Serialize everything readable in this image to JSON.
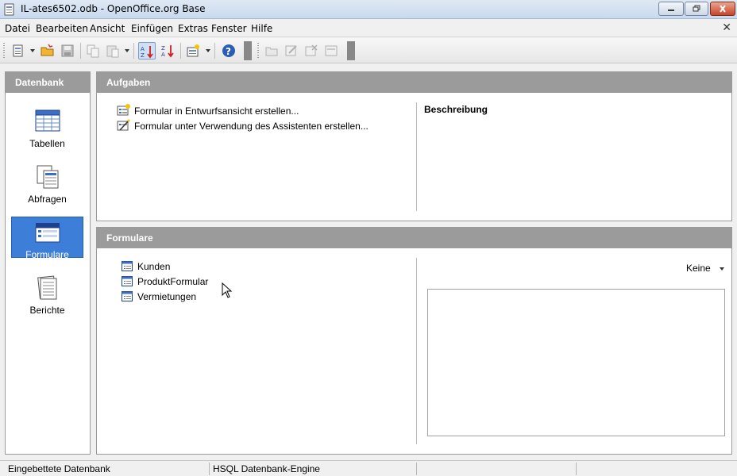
{
  "window": {
    "title": "IL-ates6502.odb - OpenOffice.org Base"
  },
  "menubar": {
    "items": [
      "Datei",
      "Bearbeiten",
      "Ansicht",
      "Einfügen",
      "Extras",
      "Fenster",
      "Hilfe"
    ]
  },
  "left_panel": {
    "header": "Datenbank",
    "items": [
      {
        "label": "Tabellen",
        "icon": "table-icon",
        "selected": false
      },
      {
        "label": "Abfragen",
        "icon": "query-icon",
        "selected": false
      },
      {
        "label": "Formulare",
        "icon": "form-icon",
        "selected": true
      },
      {
        "label": "Berichte",
        "icon": "report-icon",
        "selected": false
      }
    ]
  },
  "tasks": {
    "header": "Aufgaben",
    "items": [
      {
        "label": "Formular in Entwurfsansicht erstellen...",
        "icon": "form-design-icon"
      },
      {
        "label": "Formular unter Verwendung des Assistenten erstellen...",
        "icon": "form-wizard-icon"
      }
    ],
    "description_title": "Beschreibung"
  },
  "forms": {
    "header": "Formulare",
    "items": [
      {
        "label": "Kunden"
      },
      {
        "label": "ProduktFormular"
      },
      {
        "label": "Vermietungen"
      }
    ],
    "preview_mode": "Keine"
  },
  "statusbar": {
    "cells": [
      "Eingebettete Datenbank",
      "HSQL Datenbank-Engine",
      "",
      ""
    ]
  },
  "colors": {
    "header_bg": "#9b9b9b",
    "selection": "#3d7fd8",
    "close_button": "#c8442a"
  }
}
